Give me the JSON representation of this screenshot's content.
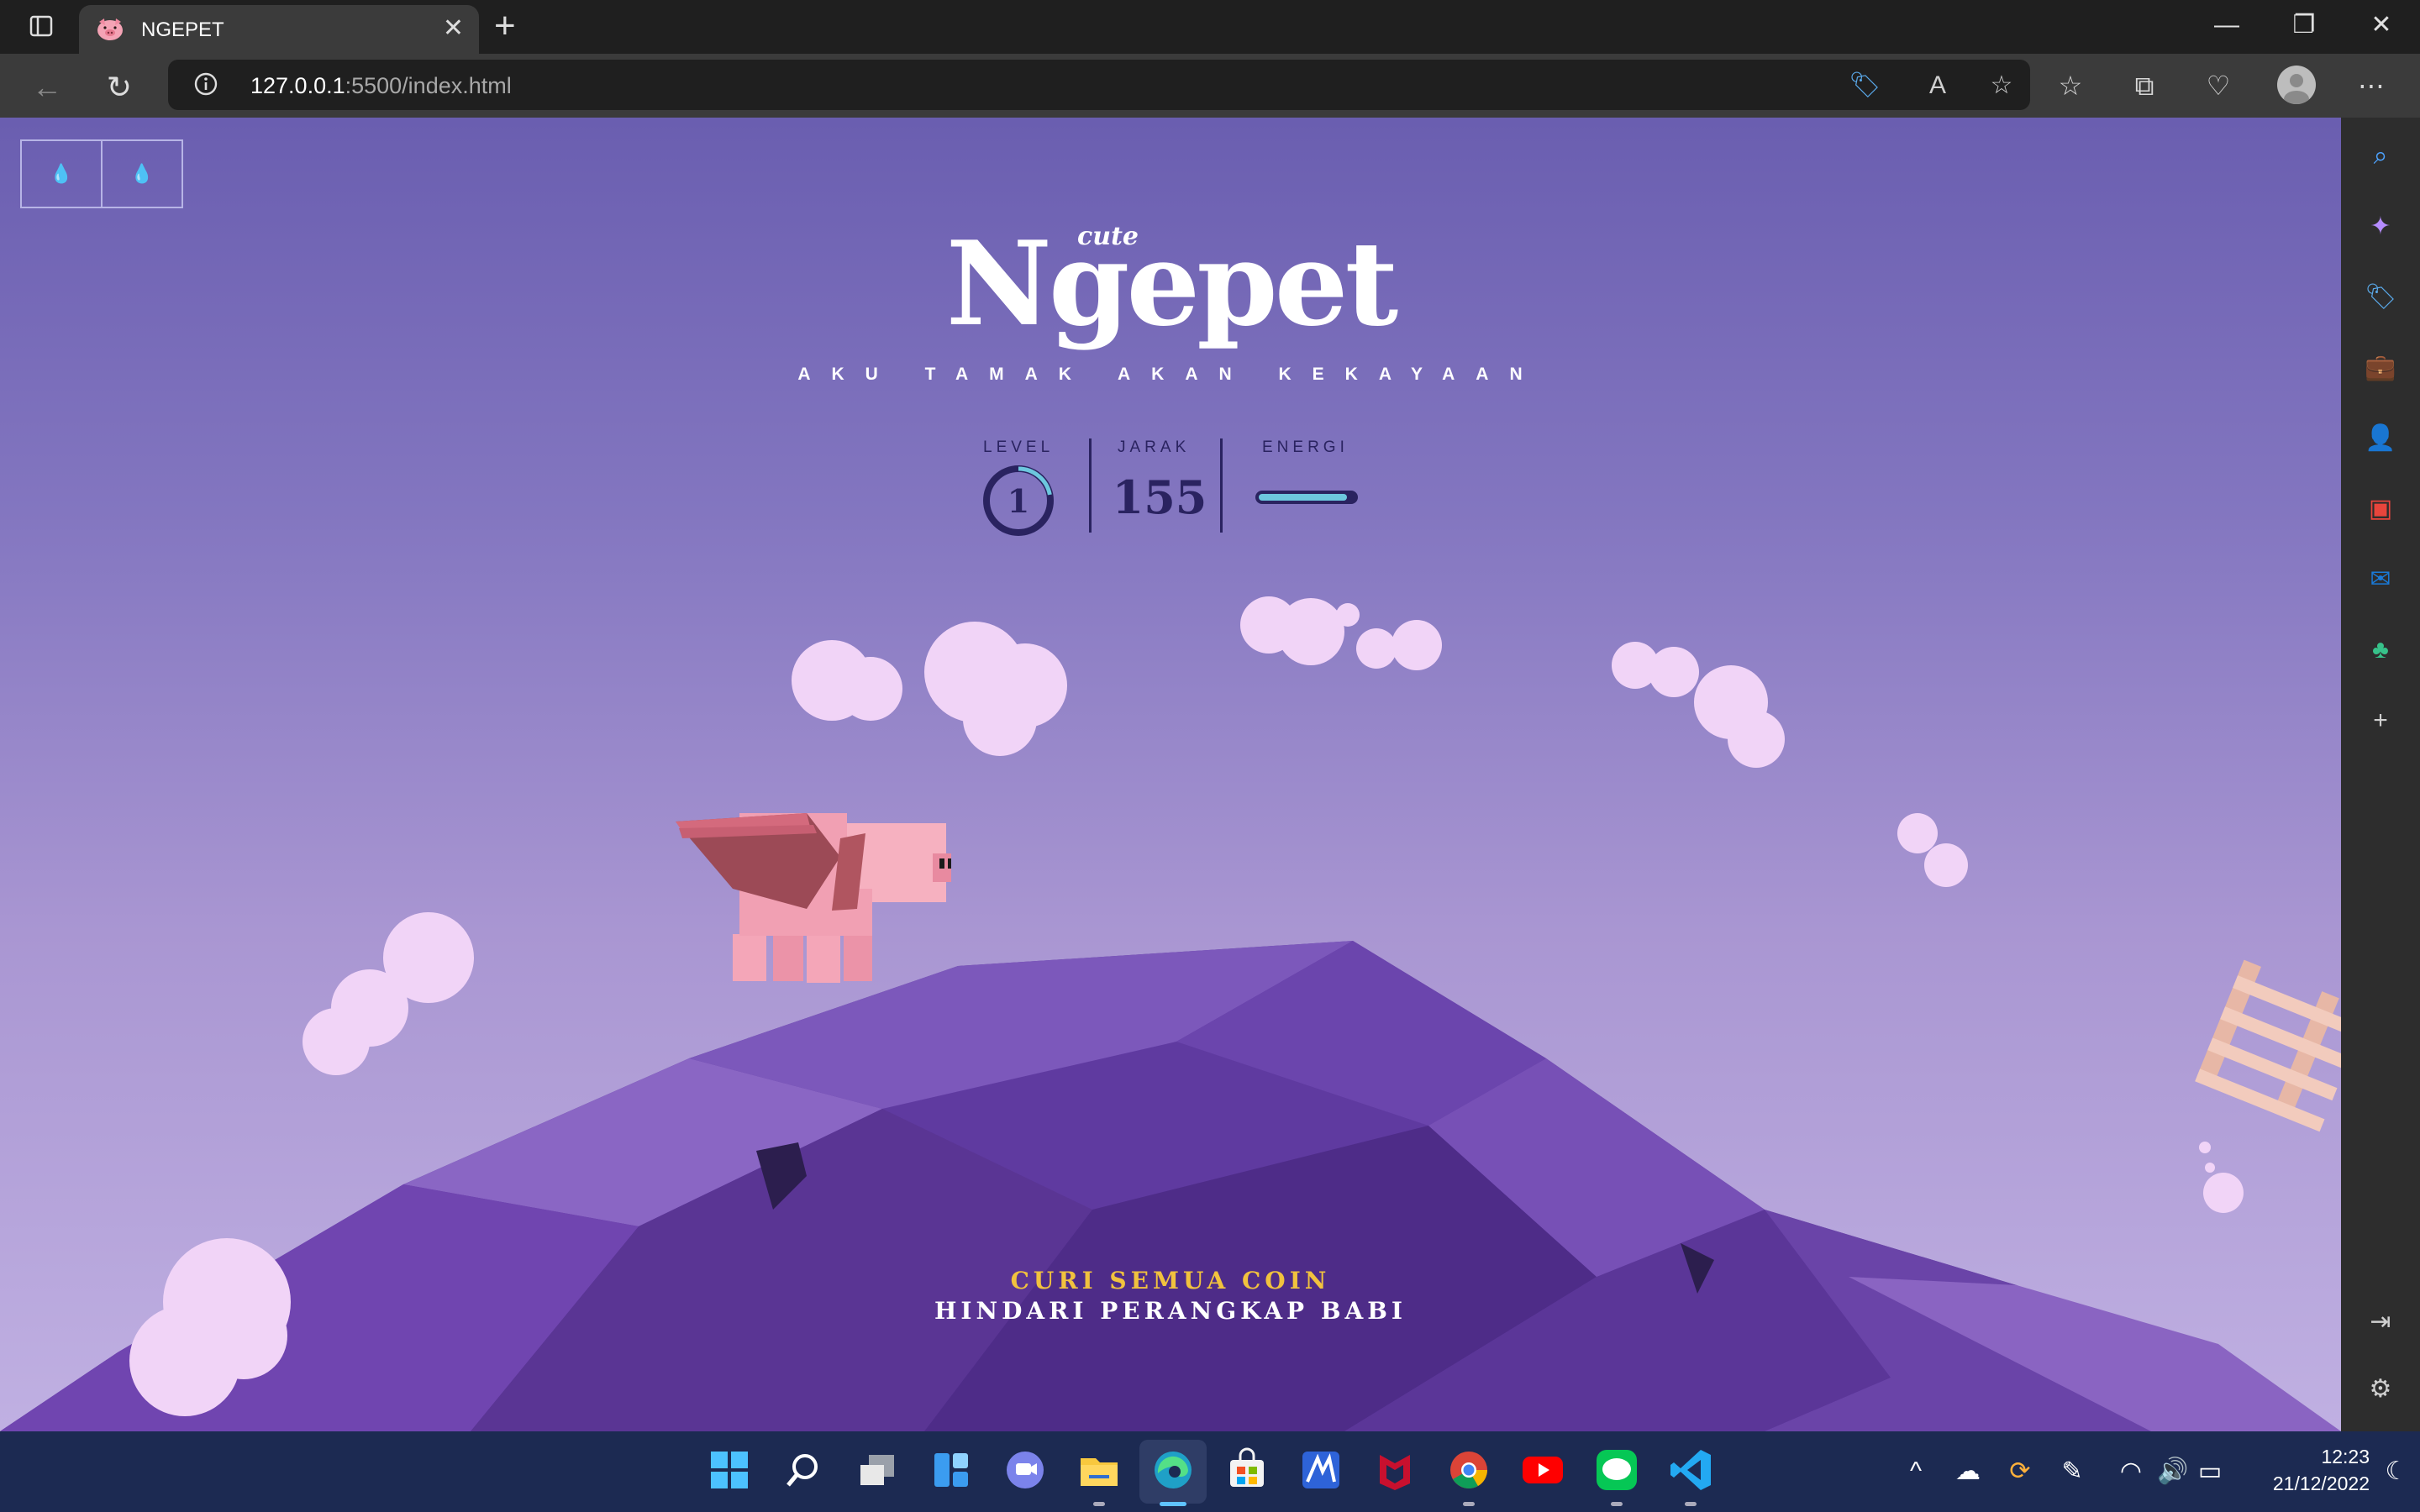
{
  "browser": {
    "tab_title": "NGEPET",
    "tab_close": "✕",
    "new_tab": "+",
    "url_host": "127.0.0.1",
    "url_rest": ":5500/index.html",
    "win_minimize": "—",
    "win_restore": "❐",
    "win_close": "✕"
  },
  "game": {
    "title_small": "cute",
    "title": "Ngepet",
    "tagline": "AKU TAMAK AKAN KEKAYAAN",
    "hud": {
      "level_label": "LEVEL",
      "level_value": "1",
      "level_progress": 0.22,
      "distance_label": "JARAK",
      "distance_value": "155",
      "energy_label": "ENERGI",
      "energy_fraction": 0.92
    },
    "message_line1": "CURI SEMUA COIN",
    "message_line2": "HINDARI PERANGKAP BABI",
    "colors": {
      "hud_dark": "#2a2360",
      "energy_fill": "#6dc7de",
      "message_highlight": "#f1c23e",
      "sky_top": "#6a5eb0",
      "sky_bottom": "#c0b0e2"
    }
  },
  "taskbar": {
    "time": "12:23",
    "date": "21/12/2022"
  }
}
